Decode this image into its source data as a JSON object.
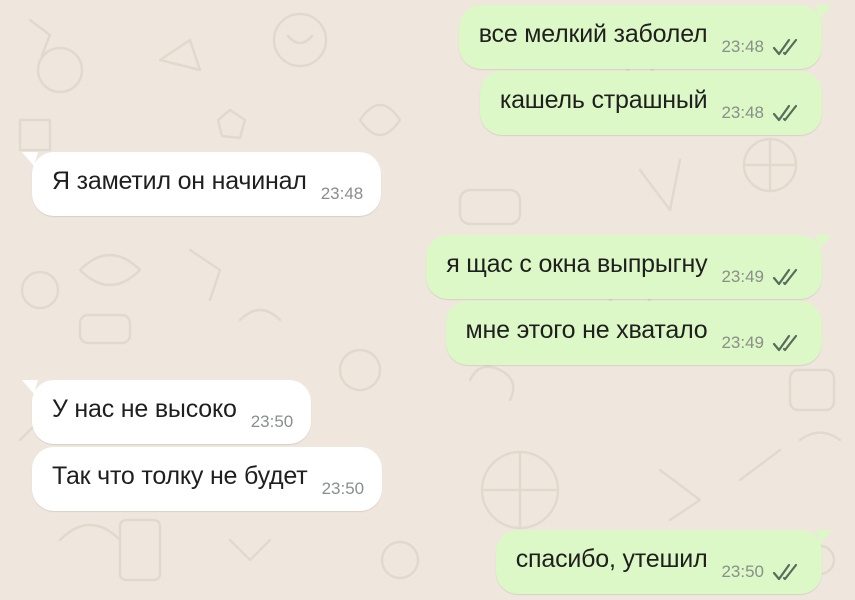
{
  "chat": {
    "colors": {
      "wallpaper": "#efe7dd",
      "outgoing_bubble": "#dcf8c6",
      "incoming_bubble": "#ffffff",
      "time_text": "#8a8f8a",
      "read_ticks": "#5b6b5b"
    },
    "messages": [
      {
        "direction": "outgoing",
        "text": "все мелкий заболел",
        "time": "23:48",
        "status_icon": "double-check-icon"
      },
      {
        "direction": "outgoing",
        "text": "кашель страшный",
        "time": "23:48",
        "status_icon": "double-check-icon"
      },
      {
        "direction": "incoming",
        "text": "Я заметил он начинал",
        "time": "23:48"
      },
      {
        "direction": "outgoing",
        "text": "я щас с окна выпрыгну",
        "time": "23:49",
        "status_icon": "double-check-icon"
      },
      {
        "direction": "outgoing",
        "text": "мне этого не хватало",
        "time": "23:49",
        "status_icon": "double-check-icon"
      },
      {
        "direction": "incoming",
        "text": "У нас не высоко",
        "time": "23:50"
      },
      {
        "direction": "incoming",
        "text": "Так что толку не будет",
        "time": "23:50"
      },
      {
        "direction": "outgoing",
        "text": "спасибо, утешил",
        "time": "23:50",
        "status_icon": "double-check-icon"
      }
    ]
  }
}
